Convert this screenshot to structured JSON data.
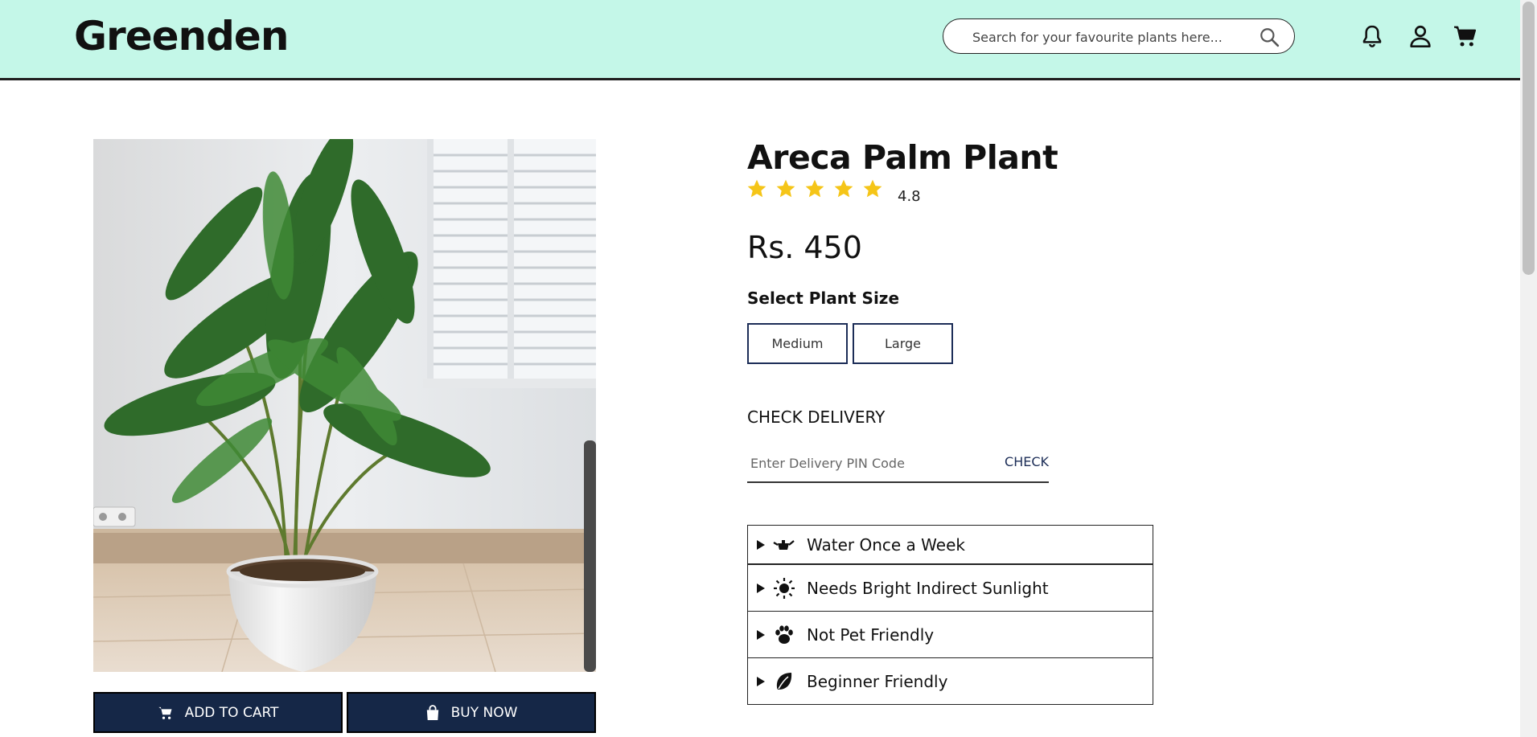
{
  "header": {
    "brand": "Greenden",
    "search_placeholder": "Search for your favourite plants here..."
  },
  "product": {
    "title": "Areca Palm Plant",
    "rating": "4.8",
    "rating_value": 5,
    "rating_max": 5,
    "price": "Rs. 450",
    "size_label": "Select Plant Size",
    "sizes": [
      "Medium",
      "Large"
    ],
    "delivery_title": "CHECK DELIVERY",
    "pin_placeholder": "Enter Delivery PIN Code",
    "pin_check_label": "CHECK",
    "add_to_cart_label": "ADD TO CART",
    "buy_now_label": "BUY NOW"
  },
  "care": [
    {
      "label": "Water Once a Week",
      "icon": "watering-can-icon"
    },
    {
      "label": "Needs Bright Indirect Sunlight",
      "icon": "sun-icon"
    },
    {
      "label": "Not Pet Friendly",
      "icon": "paw-icon"
    },
    {
      "label": "Beginner Friendly",
      "icon": "leaf-icon"
    }
  ],
  "colors": {
    "header_bg": "#c4f7e8",
    "button_dark": "#152747",
    "star": "#f5c518",
    "size_border": "#1c2d57"
  }
}
